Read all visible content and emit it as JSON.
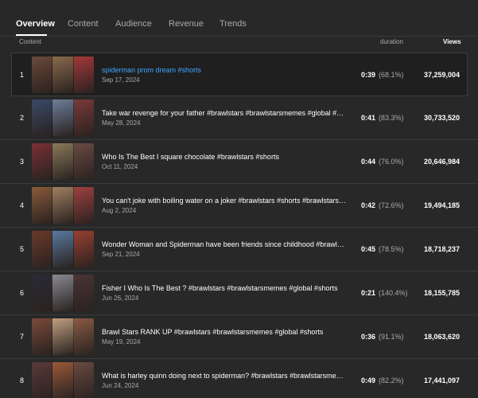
{
  "tabs": [
    {
      "label": "Overview",
      "active": true
    },
    {
      "label": "Content",
      "active": false
    },
    {
      "label": "Audience",
      "active": false
    },
    {
      "label": "Revenue",
      "active": false
    },
    {
      "label": "Trends",
      "active": false
    }
  ],
  "columns": {
    "content": "Content",
    "duration": "duration",
    "views": "Views"
  },
  "rows": [
    {
      "rank": "1",
      "title": "spiderman prom dream #shorts",
      "date": "Sep 17, 2024",
      "duration": "0:39",
      "percent": "(68.1%)",
      "views": "37,259,004",
      "selected": true,
      "thumb_colors": [
        "#6b4a3a",
        "#8a6a4c",
        "#a5383a"
      ]
    },
    {
      "rank": "2",
      "title": "Take war revenge for your father #brawlstars #brawlstarsmemes #global #shorts",
      "date": "May 28, 2024",
      "duration": "0:41",
      "percent": "(83.3%)",
      "views": "30,733,520",
      "selected": false,
      "thumb_colors": [
        "#3a4a66",
        "#6c7f9a",
        "#7a3a3a"
      ]
    },
    {
      "rank": "3",
      "title": "Who Is The Best I square chocolate #brawlstars #shorts",
      "date": "Oct 11, 2024",
      "duration": "0:44",
      "percent": "(76.0%)",
      "views": "20,646,984",
      "selected": false,
      "thumb_colors": [
        "#7a3036",
        "#8a7a5a",
        "#6a4a44"
      ]
    },
    {
      "rank": "4",
      "title": "You can't joke with boiling water on a joker #brawlstars #shorts #brawlstarsmemes",
      "date": "Aug 2, 2024",
      "duration": "0:42",
      "percent": "(72.6%)",
      "views": "19,494,185",
      "selected": false,
      "thumb_colors": [
        "#8a5a3a",
        "#a08060",
        "#a04040"
      ]
    },
    {
      "rank": "5",
      "title": "Wonder Woman and Spiderman have been friends since childhood #brawlstars #shorts",
      "date": "Sep 21, 2024",
      "duration": "0:45",
      "percent": "(78.5%)",
      "views": "18,718,237",
      "selected": false,
      "thumb_colors": [
        "#6a3a2a",
        "#5a7aa0",
        "#9a4030"
      ]
    },
    {
      "rank": "6",
      "title": "Fisher I Who Is The Best ? #brawlstars #brawlstarsmemes #global #shorts",
      "date": "Jun 26, 2024",
      "duration": "0:21",
      "percent": "(140.4%)",
      "views": "18,155,785",
      "selected": false,
      "thumb_colors": [
        "#2a2a34",
        "#8a8a92",
        "#4a3434"
      ]
    },
    {
      "rank": "7",
      "title": "Brawl Stars RANK UP #brawlstars #brawlstarsmemes #global #shorts",
      "date": "May 19, 2024",
      "duration": "0:36",
      "percent": "(91.1%)",
      "views": "18,063,620",
      "selected": false,
      "thumb_colors": [
        "#7a4a3a",
        "#c0a080",
        "#8a5a44"
      ]
    },
    {
      "rank": "8",
      "title": "What is harley quinn doing next to spiderman? #brawlstars #brawlstarsmemes #global #shorts",
      "date": "Jun 24, 2024",
      "duration": "0:49",
      "percent": "(82.2%)",
      "views": "17,441,097",
      "selected": false,
      "thumb_colors": [
        "#5a3a3a",
        "#9a5a3a",
        "#6a4a40"
      ]
    }
  ]
}
